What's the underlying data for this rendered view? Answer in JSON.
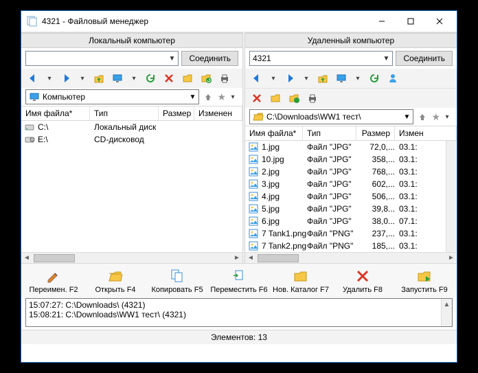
{
  "window": {
    "title": "4321 - Файловый менеджер"
  },
  "panes": {
    "left": {
      "title": "Локальный компьютер",
      "connect_label": "Соединить",
      "combo_value": "",
      "nav_combo": "Компьютер",
      "columns": {
        "name": "Имя файла*",
        "type": "Тип",
        "size": "Размер",
        "modified": "Изменен"
      },
      "files": [
        {
          "icon": "drive",
          "name": "C:\\",
          "type": "Локальный диск",
          "size": "",
          "modified": ""
        },
        {
          "icon": "cd",
          "name": "E:\\",
          "type": "CD-дисковод",
          "size": "",
          "modified": ""
        }
      ]
    },
    "right": {
      "title": "Удаленный компьютер",
      "connect_label": "Соединить",
      "combo_value": "4321",
      "nav_combo": "C:\\Downloads\\WW1 тест\\",
      "columns": {
        "name": "Имя файла*",
        "type": "Тип",
        "size": "Размер",
        "modified": "Измен"
      },
      "files": [
        {
          "icon": "img",
          "name": "1.jpg",
          "type": "Файл \"JPG\"",
          "size": "72,0,...",
          "modified": "03.1:"
        },
        {
          "icon": "img",
          "name": "10.jpg",
          "type": "Файл \"JPG\"",
          "size": "358,...",
          "modified": "03.1:"
        },
        {
          "icon": "img",
          "name": "2.jpg",
          "type": "Файл \"JPG\"",
          "size": "768,...",
          "modified": "03.1:"
        },
        {
          "icon": "img",
          "name": "3.jpg",
          "type": "Файл \"JPG\"",
          "size": "602,...",
          "modified": "03.1:"
        },
        {
          "icon": "img",
          "name": "4.jpg",
          "type": "Файл \"JPG\"",
          "size": "506,...",
          "modified": "03.1:"
        },
        {
          "icon": "img",
          "name": "5.jpg",
          "type": "Файл \"JPG\"",
          "size": "39,8...",
          "modified": "03.1:"
        },
        {
          "icon": "img",
          "name": "6.jpg",
          "type": "Файл \"JPG\"",
          "size": "38,0...",
          "modified": "07.1:"
        },
        {
          "icon": "img",
          "name": "7 Tank1.png",
          "type": "Файл \"PNG\"",
          "size": "237,...",
          "modified": "03.1:"
        },
        {
          "icon": "img",
          "name": "7 Tank2.png",
          "type": "Файл \"PNG\"",
          "size": "185,...",
          "modified": "03.1:"
        }
      ]
    }
  },
  "file_ops": [
    {
      "id": "rename",
      "label": "Переимен. F2",
      "icon": "pencil"
    },
    {
      "id": "open",
      "label": "Открыть F4",
      "icon": "open"
    },
    {
      "id": "copy",
      "label": "Копировать F5",
      "icon": "copy"
    },
    {
      "id": "move",
      "label": "Переместить F6",
      "icon": "move"
    },
    {
      "id": "newfolder",
      "label": "Нов. Каталог F7",
      "icon": "newfolder"
    },
    {
      "id": "delete",
      "label": "Удалить F8",
      "icon": "delete"
    },
    {
      "id": "run",
      "label": "Запустить F9",
      "icon": "run"
    }
  ],
  "log_lines": [
    "15:07:27: C:\\Downloads\\   (4321)",
    "15:08:21: C:\\Downloads\\WW1 тест\\   (4321)"
  ],
  "statusbar": "Элементов: 13"
}
